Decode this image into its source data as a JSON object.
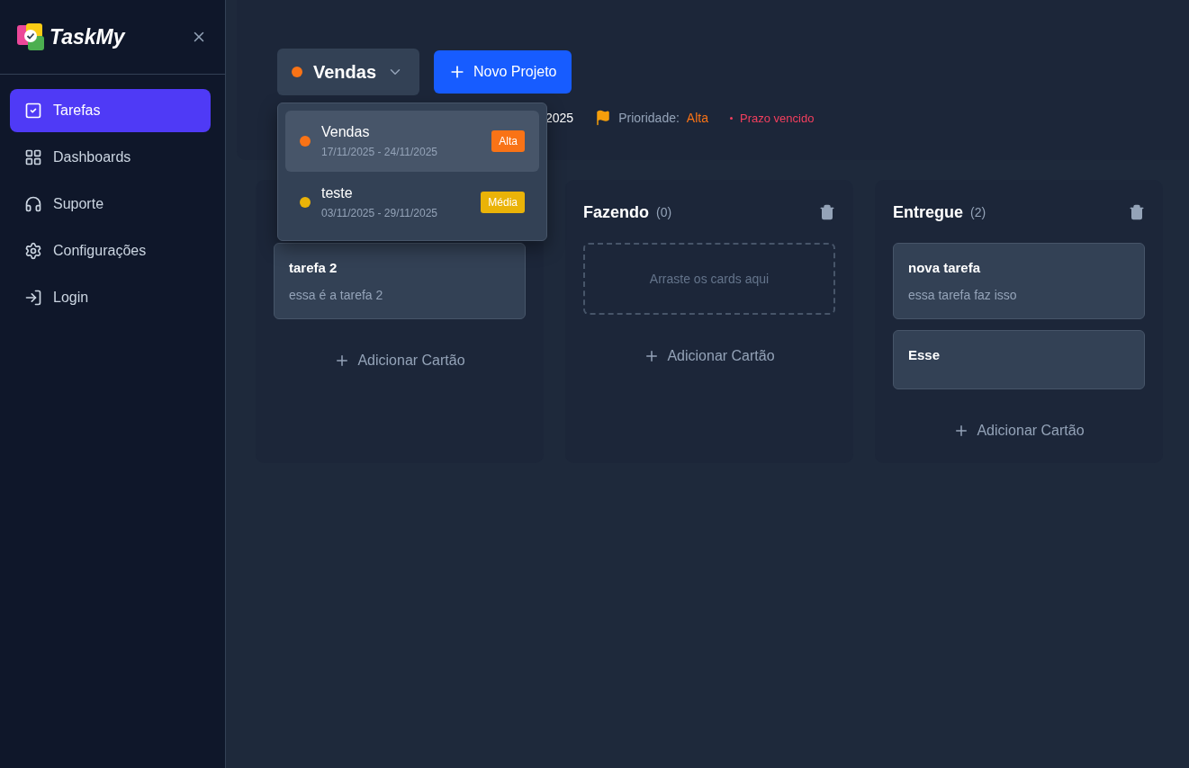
{
  "sidebar": {
    "logo": "TaskMy",
    "items": [
      {
        "label": "Tarefas",
        "selected": true
      },
      {
        "label": "Dashboards",
        "selected": false
      },
      {
        "label": "Suporte",
        "selected": false
      },
      {
        "label": "Configurações",
        "selected": false
      },
      {
        "label": "Login",
        "selected": false
      }
    ]
  },
  "header": {
    "project": {
      "name": "Vendas",
      "color": "#f97316"
    },
    "new_button": "Novo Projeto",
    "dates_visible": "2025",
    "priority_label": "Prioridade:",
    "priority_value": "Alta",
    "overdue": "Prazo vencido"
  },
  "dropdown": [
    {
      "name": "Vendas",
      "dates": "17/11/2025 - 24/11/2025",
      "badge": "Alta",
      "color": "#f97316",
      "selected": true
    },
    {
      "name": "teste",
      "dates": "03/11/2025 - 29/11/2025",
      "badge": "Média",
      "color": "#eab308",
      "selected": false
    }
  ],
  "columns": [
    {
      "cards": [
        {
          "title": "tarefa 2",
          "description": "essa é a tarefa 2"
        }
      ],
      "add": "Adicionar Cartão"
    },
    {
      "title": "Fazendo",
      "count": "(0)",
      "empty_hint": "Arraste os cards aqui",
      "add": "Adicionar Cartão",
      "show_delete": true
    },
    {
      "title": "Entregue",
      "count": "(2)",
      "cards": [
        {
          "title": "nova tarefa",
          "description": "essa tarefa faz isso"
        },
        {
          "title": "Esse"
        }
      ],
      "add": "Adicionar Cartão",
      "show_delete": true
    }
  ]
}
